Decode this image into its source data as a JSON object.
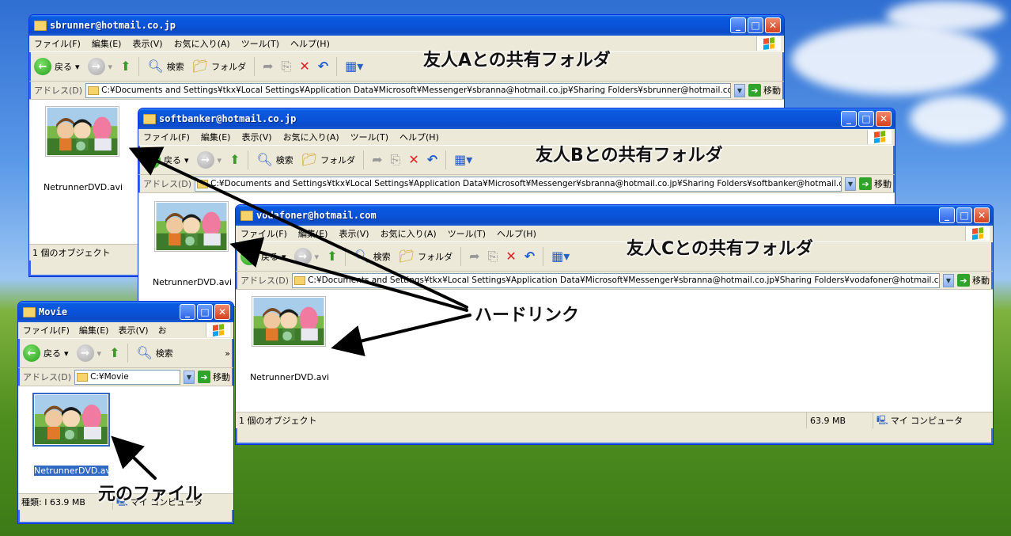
{
  "windows": {
    "a": {
      "title": "sbrunner@hotmail.co.jp",
      "address": "C:¥Documents and Settings¥tkx¥Local Settings¥Application Data¥Microsoft¥Messenger¥sbranna@hotmail.co.jp¥Sharing Folders¥sbrunner@hotmail.co.jp",
      "file": "NetrunnerDVD.avi",
      "status": "1 個のオブジェクト"
    },
    "b": {
      "title": "softbanker@hotmail.co.jp",
      "address": "C:¥Documents and Settings¥tkx¥Local Settings¥Application Data¥Microsoft¥Messenger¥sbranna@hotmail.co.jp¥Sharing Folders¥softbanker@hotmail.co.jp",
      "file": "NetrunnerDVD.avi"
    },
    "c": {
      "title": "vodafoner@hotmail.com",
      "address": "C:¥Documents and Settings¥tkx¥Local Settings¥Application Data¥Microsoft¥Messenger¥sbranna@hotmail.co.jp¥Sharing Folders¥vodafoner@hotmail.com",
      "file": "NetrunnerDVD.avi",
      "status": "1 個のオブジェクト",
      "size": "63.9 MB",
      "location": "マイ コンピュータ"
    },
    "movie": {
      "title": "Movie",
      "address": "C:¥Movie",
      "file": "NetrunnerDVD.avi",
      "status": "種類: I 63.9 MB",
      "location": "マイ コンピュータ"
    }
  },
  "menu": {
    "file": "ファイル(F)",
    "edit": "編集(E)",
    "view": "表示(V)",
    "favorites": "お気に入り(A)",
    "tools": "ツール(T)",
    "help": "ヘルプ(H)",
    "favorites_short": "お"
  },
  "toolbar": {
    "back": "戻る",
    "search": "検索",
    "folders": "フォルダ"
  },
  "address_label": "アドレス(D)",
  "go_label": "移動",
  "annotations": {
    "friend_a": "友人Aとの共有フォルダ",
    "friend_b": "友人Bとの共有フォルダ",
    "friend_c": "友人Cとの共有フォルダ",
    "hardlink": "ハードリンク",
    "original": "元のファイル"
  },
  "colors": {
    "titlebar": "#0a53d8",
    "window_bg": "#ece9d8",
    "accent": "#0831d9"
  }
}
